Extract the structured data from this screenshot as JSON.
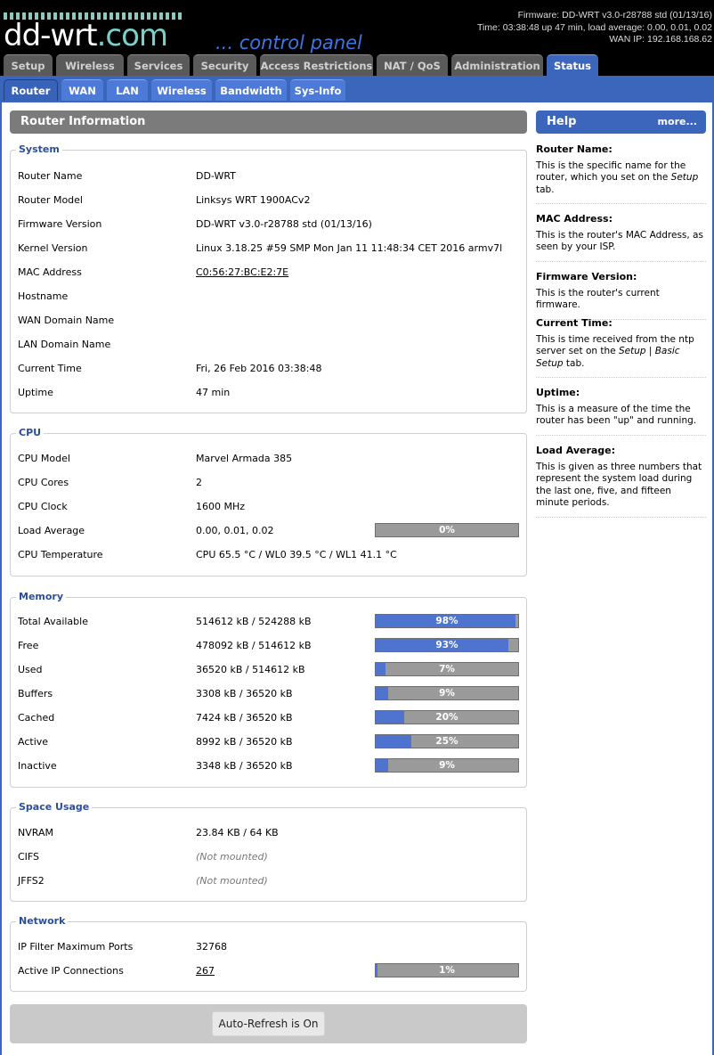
{
  "header": {
    "logo_main": "dd-wrt",
    "logo_suffix": ".com",
    "control_panel": "... control panel",
    "firmware_line": "Firmware: DD-WRT v3.0-r28788 std (01/13/16)",
    "time_line": "Time: 03:38:48 up 47 min, load average: 0.00, 0.01, 0.02",
    "wan_line": "WAN IP: 192.168.168.62"
  },
  "main_tabs": [
    "Setup",
    "Wireless",
    "Services",
    "Security",
    "Access Restrictions",
    "NAT / QoS",
    "Administration",
    "Status"
  ],
  "sub_tabs": [
    "Router",
    "WAN",
    "LAN",
    "Wireless",
    "Bandwidth",
    "Sys-Info"
  ],
  "page_title": "Router Information",
  "system": {
    "legend": "System",
    "rows": [
      {
        "label": "Router Name",
        "value": "DD-WRT"
      },
      {
        "label": "Router Model",
        "value": "Linksys WRT 1900ACv2"
      },
      {
        "label": "Firmware Version",
        "value": "DD-WRT v3.0-r28788 std (01/13/16)"
      },
      {
        "label": "Kernel Version",
        "value": "Linux 3.18.25 #59 SMP Mon Jan 11 11:48:34 CET 2016 armv7l"
      },
      {
        "label": "MAC Address",
        "value": "C0:56:27:BC:E2:7E"
      },
      {
        "label": "Hostname",
        "value": ""
      },
      {
        "label": "WAN Domain Name",
        "value": ""
      },
      {
        "label": "LAN Domain Name",
        "value": ""
      },
      {
        "label": "Current Time",
        "value": "Fri, 26 Feb 2016 03:38:48"
      },
      {
        "label": "Uptime",
        "value": "47 min"
      }
    ]
  },
  "cpu": {
    "legend": "CPU",
    "rows": [
      {
        "label": "CPU Model",
        "value": "Marvel Armada 385"
      },
      {
        "label": "CPU Cores",
        "value": "2"
      },
      {
        "label": "CPU Clock",
        "value": "1600 MHz"
      },
      {
        "label": "Load Average",
        "value": "0.00, 0.01, 0.02",
        "percent": 0,
        "percent_label": "0%"
      },
      {
        "label": "CPU Temperature",
        "value": "CPU 65.5 °C / WL0 39.5 °C / WL1 41.1 °C"
      }
    ]
  },
  "memory": {
    "legend": "Memory",
    "rows": [
      {
        "label": "Total Available",
        "value": "514612 kB / 524288 kB",
        "percent": 98,
        "percent_label": "98%"
      },
      {
        "label": "Free",
        "value": "478092 kB / 514612 kB",
        "percent": 93,
        "percent_label": "93%"
      },
      {
        "label": "Used",
        "value": "36520 kB / 514612 kB",
        "percent": 7,
        "percent_label": "7%"
      },
      {
        "label": "Buffers",
        "value": "3308 kB / 36520 kB",
        "percent": 9,
        "percent_label": "9%"
      },
      {
        "label": "Cached",
        "value": "7424 kB / 36520 kB",
        "percent": 20,
        "percent_label": "20%"
      },
      {
        "label": "Active",
        "value": "8992 kB / 36520 kB",
        "percent": 25,
        "percent_label": "25%"
      },
      {
        "label": "Inactive",
        "value": "3348 kB / 36520 kB",
        "percent": 9,
        "percent_label": "9%"
      }
    ]
  },
  "space": {
    "legend": "Space Usage",
    "rows": [
      {
        "label": "NVRAM",
        "value": "23.84 KB / 64 KB"
      },
      {
        "label": "CIFS",
        "value": "(Not mounted)"
      },
      {
        "label": "JFFS2",
        "value": "(Not mounted)"
      }
    ]
  },
  "network": {
    "legend": "Network",
    "rows": [
      {
        "label": "IP Filter Maximum Ports",
        "value": "32768"
      },
      {
        "label": "Active IP Connections",
        "value": "267",
        "percent": 1,
        "percent_label": "1%"
      }
    ]
  },
  "refresh_label": "Auto-Refresh is On",
  "help": {
    "title": "Help",
    "more": "more...",
    "sections": [
      {
        "heading": "Router Name:",
        "text_a": "This is the specific name for the router, which you set on the ",
        "em": "Setup",
        "text_b": " tab."
      },
      {
        "heading": "MAC Address:",
        "text_a": "This is the router's MAC Address, as seen by your ISP.",
        "em": "",
        "text_b": ""
      },
      {
        "heading": "Firmware Version:",
        "text_a": "This is the router's current firmware.",
        "em": "",
        "text_b": ""
      },
      {
        "heading": "Current Time:",
        "text_a": "This is time received from the ntp server set on the ",
        "em": "Setup | Basic Setup",
        "text_b": " tab."
      },
      {
        "heading": "Uptime:",
        "text_a": "This is a measure of the time the router has been \"up\" and running.",
        "em": "",
        "text_b": ""
      },
      {
        "heading": "Load Average:",
        "text_a": "This is given as three numbers that represent the system load during the last one, five, and fifteen minute periods.",
        "em": "",
        "text_b": ""
      }
    ]
  },
  "colors": {
    "accent": "#3c66bb",
    "bar_fill": "#4f74cf",
    "bar_bg": "#9a9a9a",
    "section_title_bg": "#7b7b7b"
  }
}
